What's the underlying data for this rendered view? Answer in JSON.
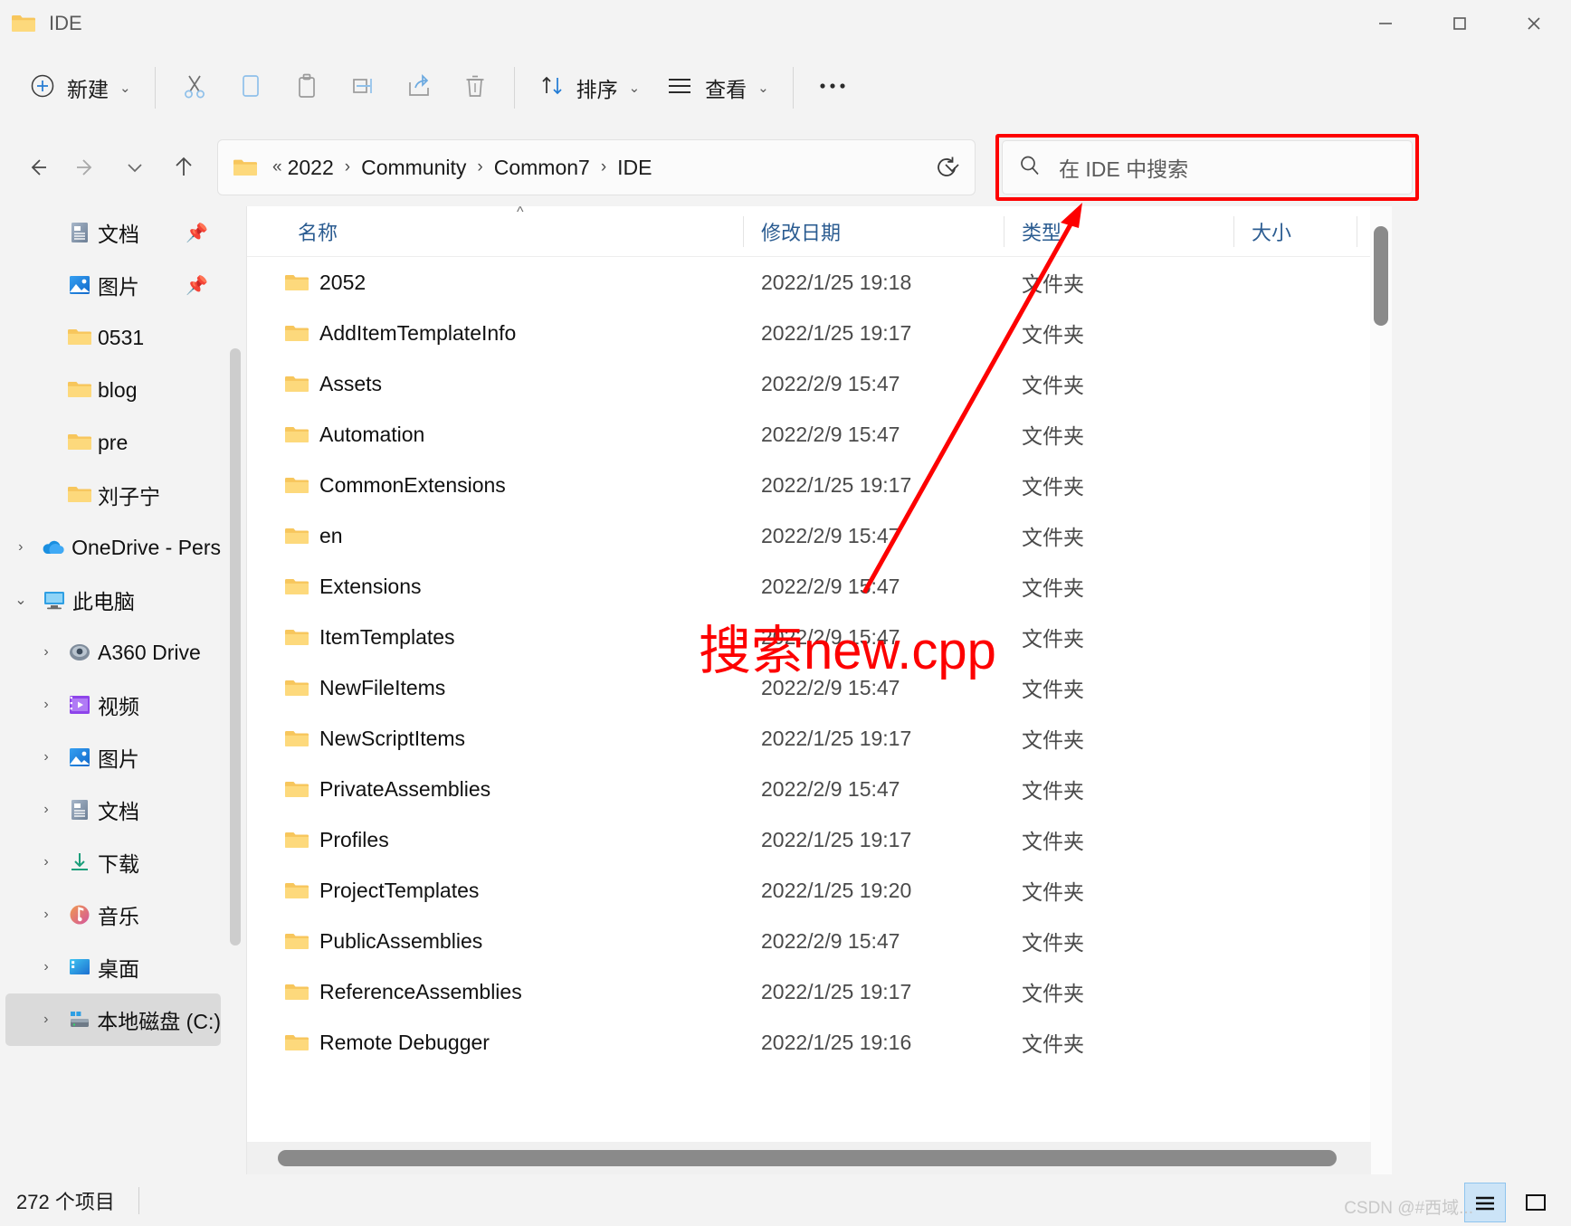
{
  "window": {
    "title": "IDE",
    "folder_icon": "folder-icon",
    "controls": {
      "minimize": "—",
      "maximize": "▢",
      "close": "✕"
    }
  },
  "toolbar": {
    "new_label": "新建",
    "new_icon": "plus-circle-icon",
    "cut_icon": "cut-icon",
    "copy_icon": "copy-icon",
    "paste_icon": "paste-icon",
    "rename_icon": "rename-icon",
    "share_icon": "share-icon",
    "delete_icon": "trash-icon",
    "sort_label": "排序",
    "sort_icon": "sort-arrows-icon",
    "view_label": "查看",
    "view_icon": "list-lines-icon",
    "more_label": "···",
    "chevron": "⌄"
  },
  "nav": {
    "back_icon": "arrow-left-icon",
    "forward_icon": "arrow-right-icon",
    "recent_icon": "chevron-down-icon",
    "up_icon": "arrow-up-icon",
    "refresh_icon": "refresh-icon",
    "address_caret": "⌄",
    "overflow": "«",
    "breadcrumbs": [
      "2022",
      "Community",
      "Common7",
      "IDE"
    ],
    "separator": "›"
  },
  "search": {
    "placeholder": "在 IDE 中搜索",
    "icon": "search-icon",
    "highlight_color": "#fd0000"
  },
  "sidebar": {
    "items": [
      {
        "label": "文档",
        "icon": "documents-icon",
        "expander": "",
        "pinned": true,
        "indent": 0,
        "selected": false
      },
      {
        "label": "图片",
        "icon": "pictures-icon",
        "expander": "",
        "pinned": true,
        "indent": 0,
        "selected": false
      },
      {
        "label": "0531",
        "icon": "folder-icon",
        "expander": "",
        "pinned": false,
        "indent": 0,
        "selected": false
      },
      {
        "label": "blog",
        "icon": "folder-icon",
        "expander": "",
        "pinned": false,
        "indent": 0,
        "selected": false
      },
      {
        "label": "pre",
        "icon": "folder-icon",
        "expander": "",
        "pinned": false,
        "indent": 0,
        "selected": false
      },
      {
        "label": "刘子宁",
        "icon": "folder-icon",
        "expander": "",
        "pinned": false,
        "indent": 0,
        "selected": false
      },
      {
        "label": "OneDrive - Pers",
        "icon": "onedrive-icon",
        "expander": "›",
        "pinned": false,
        "indent": 1,
        "selected": false
      },
      {
        "label": "此电脑",
        "icon": "thispc-icon",
        "expander": "⌄",
        "pinned": false,
        "indent": 1,
        "selected": false
      },
      {
        "label": "A360 Drive",
        "icon": "a360-icon",
        "expander": "›",
        "pinned": false,
        "indent": 2,
        "selected": false
      },
      {
        "label": "视频",
        "icon": "videos-icon",
        "expander": "›",
        "pinned": false,
        "indent": 2,
        "selected": false
      },
      {
        "label": "图片",
        "icon": "pictures-icon",
        "expander": "›",
        "pinned": false,
        "indent": 2,
        "selected": false
      },
      {
        "label": "文档",
        "icon": "documents-icon",
        "expander": "›",
        "pinned": false,
        "indent": 2,
        "selected": false
      },
      {
        "label": "下载",
        "icon": "downloads-icon",
        "expander": "›",
        "pinned": false,
        "indent": 2,
        "selected": false
      },
      {
        "label": "音乐",
        "icon": "music-icon",
        "expander": "›",
        "pinned": false,
        "indent": 2,
        "selected": false
      },
      {
        "label": "桌面",
        "icon": "desktop-icon",
        "expander": "›",
        "pinned": false,
        "indent": 2,
        "selected": false
      },
      {
        "label": "本地磁盘 (C:)",
        "icon": "drive-icon",
        "expander": "›",
        "pinned": false,
        "indent": 2,
        "selected": true
      }
    ]
  },
  "filelist": {
    "columns": {
      "name": "名称",
      "date": "修改日期",
      "type": "类型",
      "size": "大小"
    },
    "sort_indicator": "^",
    "rows": [
      {
        "name": "2052",
        "date": "2022/1/25 19:18",
        "type": "文件夹",
        "size": ""
      },
      {
        "name": "AddItemTemplateInfo",
        "date": "2022/1/25 19:17",
        "type": "文件夹",
        "size": ""
      },
      {
        "name": "Assets",
        "date": "2022/2/9 15:47",
        "type": "文件夹",
        "size": ""
      },
      {
        "name": "Automation",
        "date": "2022/2/9 15:47",
        "type": "文件夹",
        "size": ""
      },
      {
        "name": "CommonExtensions",
        "date": "2022/1/25 19:17",
        "type": "文件夹",
        "size": ""
      },
      {
        "name": "en",
        "date": "2022/2/9 15:47",
        "type": "文件夹",
        "size": ""
      },
      {
        "name": "Extensions",
        "date": "2022/2/9 15:47",
        "type": "文件夹",
        "size": ""
      },
      {
        "name": "ItemTemplates",
        "date": "2022/2/9 15:47",
        "type": "文件夹",
        "size": ""
      },
      {
        "name": "NewFileItems",
        "date": "2022/2/9 15:47",
        "type": "文件夹",
        "size": ""
      },
      {
        "name": "NewScriptItems",
        "date": "2022/1/25 19:17",
        "type": "文件夹",
        "size": ""
      },
      {
        "name": "PrivateAssemblies",
        "date": "2022/2/9 15:47",
        "type": "文件夹",
        "size": ""
      },
      {
        "name": "Profiles",
        "date": "2022/1/25 19:17",
        "type": "文件夹",
        "size": ""
      },
      {
        "name": "ProjectTemplates",
        "date": "2022/1/25 19:20",
        "type": "文件夹",
        "size": ""
      },
      {
        "name": "PublicAssemblies",
        "date": "2022/2/9 15:47",
        "type": "文件夹",
        "size": ""
      },
      {
        "name": "ReferenceAssemblies",
        "date": "2022/1/25 19:17",
        "type": "文件夹",
        "size": ""
      },
      {
        "name": "Remote Debugger",
        "date": "2022/1/25 19:16",
        "type": "文件夹",
        "size": ""
      }
    ]
  },
  "status": {
    "item_count": "272 个项目",
    "details_view_icon": "details-view-icon",
    "tiles_view_icon": "tiles-view-icon"
  },
  "annotations": {
    "callout_text": "搜索new.cpp",
    "color": "#fd0000",
    "arrow": "arrow-to-search-box"
  },
  "watermark": {
    "text": "CSDN @#西域..."
  }
}
